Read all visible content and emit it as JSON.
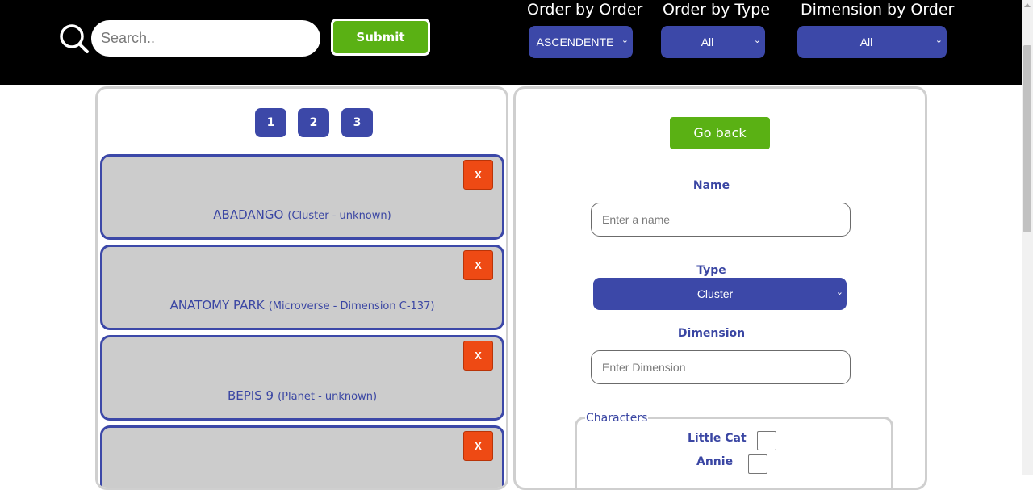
{
  "search": {
    "placeholder": "Search..",
    "submit_label": "Submit"
  },
  "filters": [
    {
      "label": "Order by Order",
      "selected": "ASCENDENTE"
    },
    {
      "label": "Order by Type",
      "selected": "All"
    },
    {
      "label": "Dimension by Order",
      "selected": "All"
    }
  ],
  "pagination": {
    "pages": [
      "1",
      "2",
      "3"
    ]
  },
  "cards": [
    {
      "name": "ABADANGO",
      "meta": "(Cluster - unknown)",
      "delete_label": "X"
    },
    {
      "name": "ANATOMY PARK",
      "meta": "(Microverse - Dimension C-137)",
      "delete_label": "X"
    },
    {
      "name": "BEPIS 9",
      "meta": "(Planet - unknown)",
      "delete_label": "X"
    },
    {
      "name": "",
      "meta": "",
      "delete_label": "X"
    }
  ],
  "form": {
    "back_label": "Go back",
    "name_label": "Name",
    "name_placeholder": "Enter a name",
    "type_label": "Type",
    "type_selected": "Cluster",
    "dimension_label": "Dimension",
    "dimension_placeholder": "Enter Dimension",
    "characters_legend": "Characters",
    "characters": [
      {
        "name": "Little Cat"
      },
      {
        "name": "Annie"
      }
    ]
  },
  "colors": {
    "accent": "#3c48a8",
    "green": "#5ab114",
    "danger": "#ee4a14",
    "topbar": "#000000",
    "card_bg": "#cccccc"
  }
}
